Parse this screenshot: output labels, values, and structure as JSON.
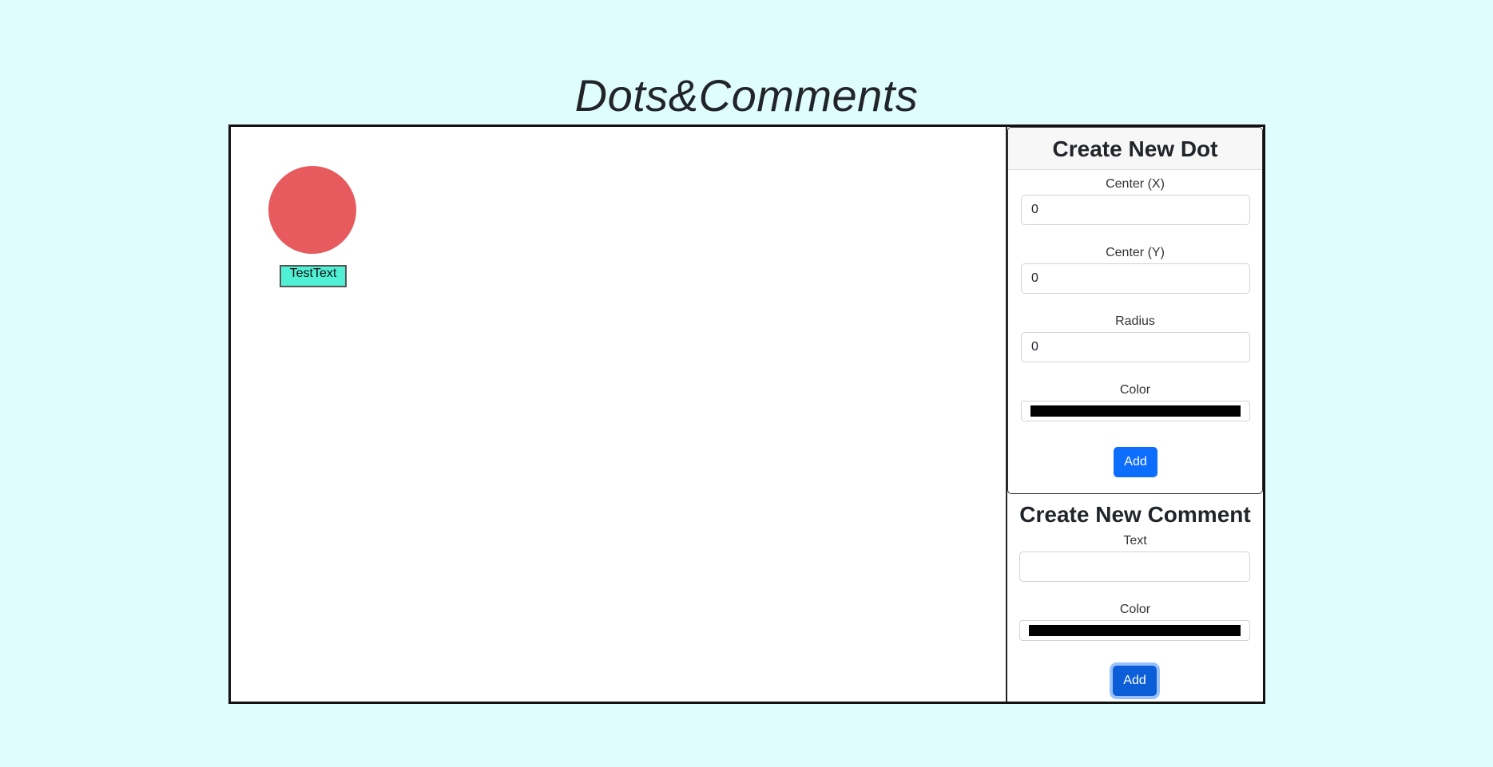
{
  "app": {
    "title": "Dots&Comments"
  },
  "canvas": {
    "dot_color": "#e75a5e",
    "comment": {
      "text": "TestText",
      "background": "#4ff0d6"
    }
  },
  "create_dot": {
    "title": "Create New Dot",
    "center_x_label": "Center (X)",
    "center_x_value": "0",
    "center_y_label": "Center (Y)",
    "center_y_value": "0",
    "radius_label": "Radius",
    "radius_value": "0",
    "color_label": "Color",
    "color_value": "#000000",
    "add_label": "Add"
  },
  "create_comment": {
    "title": "Create New Comment",
    "text_label": "Text",
    "text_value": "",
    "color_label": "Color",
    "color_value": "#000000",
    "add_label": "Add"
  },
  "colors": {
    "background": "#e0fdfd",
    "accent": "#0d6efd"
  }
}
